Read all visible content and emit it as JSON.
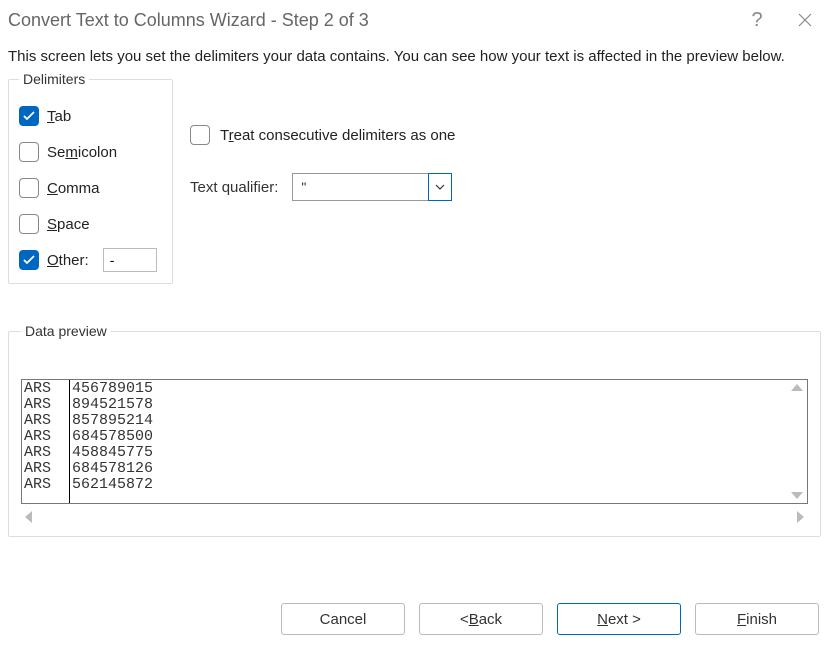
{
  "title": "Convert Text to Columns Wizard - Step 2 of 3",
  "description": "This screen lets you set the delimiters your data contains.  You can see how your text is affected in the preview below.",
  "delimiters": {
    "legend": "Delimiters",
    "tab": {
      "label_pre": "",
      "ul": "T",
      "label_post": "ab",
      "checked": true
    },
    "semicolon": {
      "label_pre": "Se",
      "ul": "m",
      "label_post": "icolon",
      "checked": false
    },
    "comma": {
      "label_pre": "",
      "ul": "C",
      "label_post": "omma",
      "checked": false
    },
    "space": {
      "label_pre": "",
      "ul": "S",
      "label_post": "pace",
      "checked": false
    },
    "other": {
      "label_pre": "",
      "ul": "O",
      "label_post": "ther:",
      "checked": true,
      "value": "-"
    }
  },
  "treat": {
    "label_pre": "T",
    "ul": "r",
    "label_post": "eat consecutive delimiters as one",
    "checked": false
  },
  "qualifier": {
    "label_pre": "Text ",
    "ul": "q",
    "label_post": "ualifier:",
    "value": "\""
  },
  "preview": {
    "legend_pre": "Data ",
    "legend_ul": "p",
    "legend_post": "review",
    "rows": [
      [
        "ARS",
        "456789015"
      ],
      [
        "ARS",
        "894521578"
      ],
      [
        "ARS",
        "857895214"
      ],
      [
        "ARS",
        "684578500"
      ],
      [
        "ARS",
        "458845775"
      ],
      [
        "ARS",
        "684578126"
      ],
      [
        "ARS",
        "562145872"
      ]
    ]
  },
  "buttons": {
    "cancel": "Cancel",
    "back_pre": "< ",
    "back_ul": "B",
    "back_post": "ack",
    "next_ul": "N",
    "next_post": "ext >",
    "finish_ul": "F",
    "finish_post": "inish"
  }
}
